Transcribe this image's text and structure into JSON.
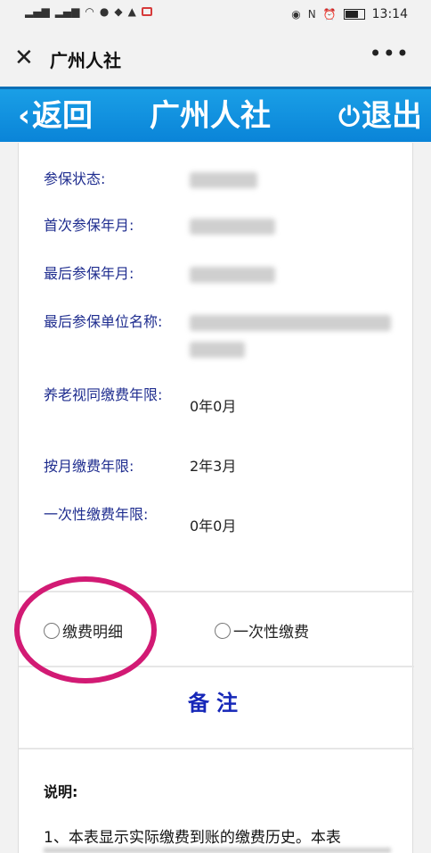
{
  "status_bar": {
    "time": "13:14"
  },
  "wechat_bar": {
    "title": "广州人社",
    "close_icon": "close-icon",
    "more_icon": "more-icon"
  },
  "header": {
    "back_label": "返回",
    "title": "广州人社",
    "logout_label": "退出",
    "color": "#0a84d8"
  },
  "info": {
    "rows": [
      {
        "label": "参保状态:",
        "value": ""
      },
      {
        "label": "首次参保年月:",
        "value": ""
      },
      {
        "label": "最后参保年月:",
        "value": ""
      },
      {
        "label": "最后参保单位名称:",
        "value": ""
      },
      {
        "label": "养老视同缴费年限:",
        "value": "0年0月"
      },
      {
        "label": "按月缴费年限:",
        "value": "2年3月"
      },
      {
        "label": "一次性缴费年限:",
        "value": "0年0月"
      }
    ]
  },
  "options": {
    "detail_label": "缴费明细",
    "lump_label": "一次性缴费",
    "highlight_color": "#d21a74"
  },
  "remark": {
    "title": "备注"
  },
  "notes": {
    "title": "说明:",
    "line1": "1、本表显示实际缴费到账的缴费历史。本表"
  }
}
